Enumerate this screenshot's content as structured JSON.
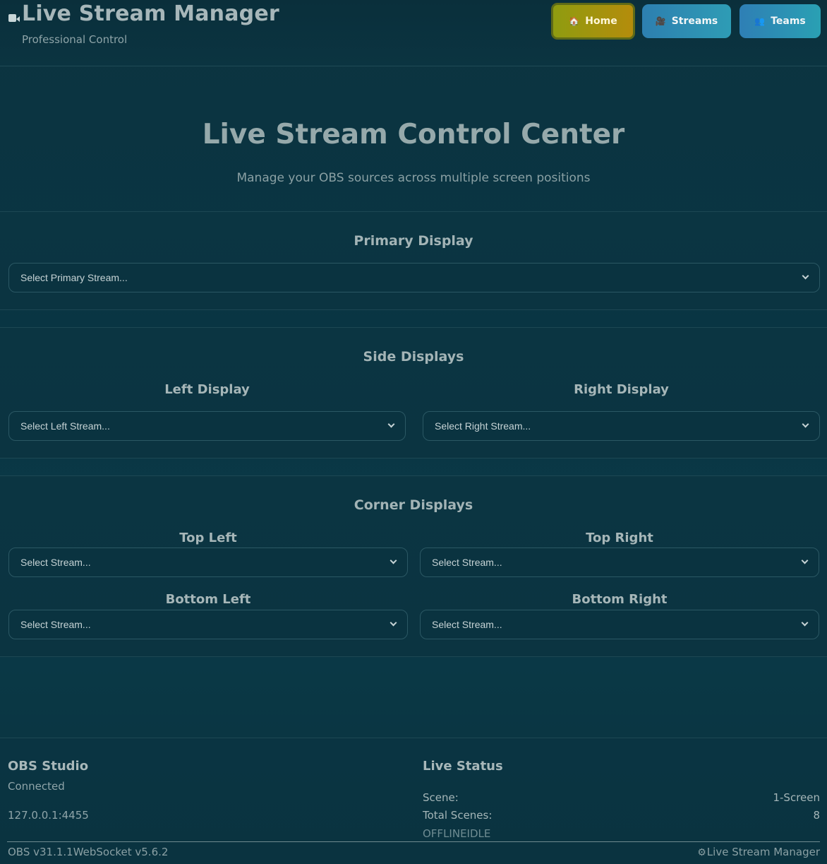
{
  "header": {
    "title": "Live Stream Manager",
    "subtitle": "Professional Control",
    "brand_icon": "video-camera-icon",
    "nav": [
      {
        "label": "Home",
        "icon": "house-icon",
        "active": true
      },
      {
        "label": "Streams",
        "icon": "film-camera-icon",
        "active": false
      },
      {
        "label": "Teams",
        "icon": "people-icon",
        "active": false
      }
    ]
  },
  "hero": {
    "title": "Live Stream Control Center",
    "subtitle": "Manage your OBS sources across multiple screen positions"
  },
  "primary": {
    "title": "Primary Display",
    "select_placeholder": "Select Primary Stream..."
  },
  "side": {
    "title": "Side Displays",
    "left_label": "Left Display",
    "left_placeholder": "Select Left Stream...",
    "right_label": "Right Display",
    "right_placeholder": "Select Right Stream..."
  },
  "corner": {
    "title": "Corner Displays",
    "top_left_label": "Top Left",
    "top_right_label": "Top Right",
    "bottom_left_label": "Bottom Left",
    "bottom_right_label": "Bottom Right",
    "placeholder": "Select Stream..."
  },
  "footer": {
    "obs_title": "OBS Studio",
    "obs_status": "Connected",
    "obs_address": "127.0.0.1:4455",
    "live_title": "Live Status",
    "scene_label": "Scene:",
    "scene_value": "1-Screen",
    "total_label": "Total Scenes:",
    "total_value": "8",
    "state": "OFFLINEIDLE",
    "version": "OBS v31.1.1WebSocket v5.6.2",
    "brand": "Live Stream Manager"
  },
  "colors": {
    "background": "#0b3441",
    "home_button": "#a8950e",
    "nav_button": "#2e8fb3"
  }
}
